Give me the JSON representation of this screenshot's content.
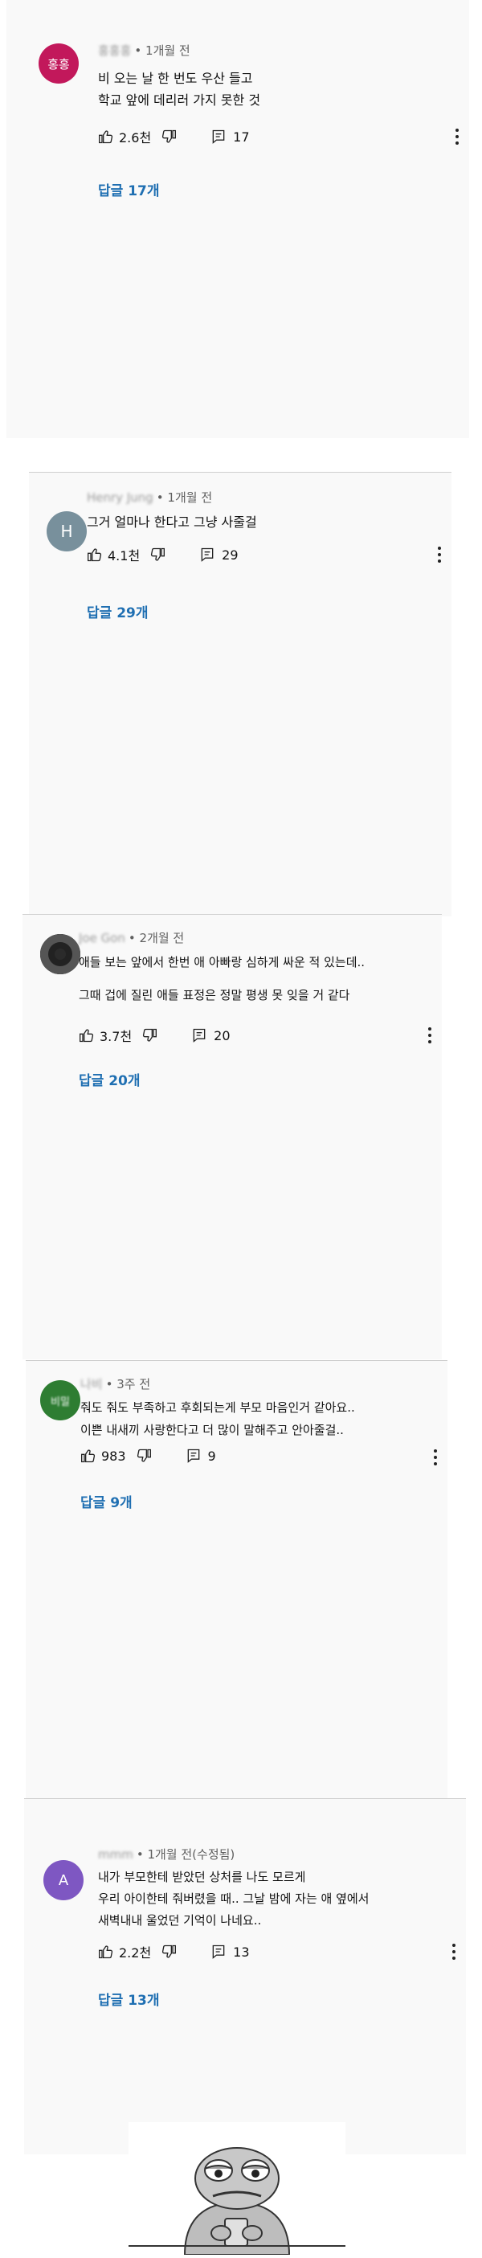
{
  "comments": [
    {
      "avatar_text": "홍홍",
      "avatar_color": "#c2185b",
      "author": "홍홍홍",
      "time": "• 1개월 전",
      "lines": [
        "비 오는 날 한 번도 우산 들고",
        "학교 앞에 데리러 가지 못한 것"
      ],
      "likes": "2.6천",
      "reply_count": "17",
      "replies_label": "답글 17개"
    },
    {
      "avatar_text": "H",
      "avatar_color": "#78909c",
      "author": "Henry Jung",
      "time": "• 1개월 전",
      "lines": [
        "그거 얼마나 한다고 그냥 사줄걸"
      ],
      "likes": "4.1천",
      "reply_count": "29",
      "replies_label": "답글 29개"
    },
    {
      "avatar_text": "",
      "avatar_color": "#2b2b2b",
      "author": "Joe Gon",
      "time": "• 2개월 전",
      "lines": [
        "애들 보는 앞에서 한번 애 아빠랑 심하게 싸운 적 있는데..",
        "",
        "그때 겁에 질린 애들 표정은 정말 평생 못 잊을 거 같다"
      ],
      "likes": "3.7천",
      "reply_count": "20",
      "replies_label": "답글 20개"
    },
    {
      "avatar_text": "비밀",
      "avatar_color": "#2e7d32",
      "author": "나비",
      "time": "• 3주 전",
      "lines": [
        "줘도 줘도 부족하고 후회되는게 부모 마음인거 같아요..",
        "이쁜 내새끼 사랑한다고 더 많이 말해주고 안아줄걸.."
      ],
      "likes": "983",
      "reply_count": "9",
      "replies_label": "답글 9개"
    },
    {
      "avatar_text": "A",
      "avatar_color": "#7e57c2",
      "author": "mmm",
      "time": "• 1개월 전(수정됨)",
      "lines": [
        "내가 부모한테 받았던 상처를 나도 모르게",
        "우리 아이한테 줘버렸을 때.. 그날 밤에 자는 애 옆에서",
        "새벽내내 울었던 기억이 나네요.."
      ],
      "likes": "2.2천",
      "reply_count": "13",
      "replies_label": "답글 13개"
    }
  ],
  "icons": {
    "like": "thumbs-up-icon",
    "dislike": "thumbs-down-icon",
    "reply": "reply-icon",
    "more": "more-vertical-icon"
  }
}
